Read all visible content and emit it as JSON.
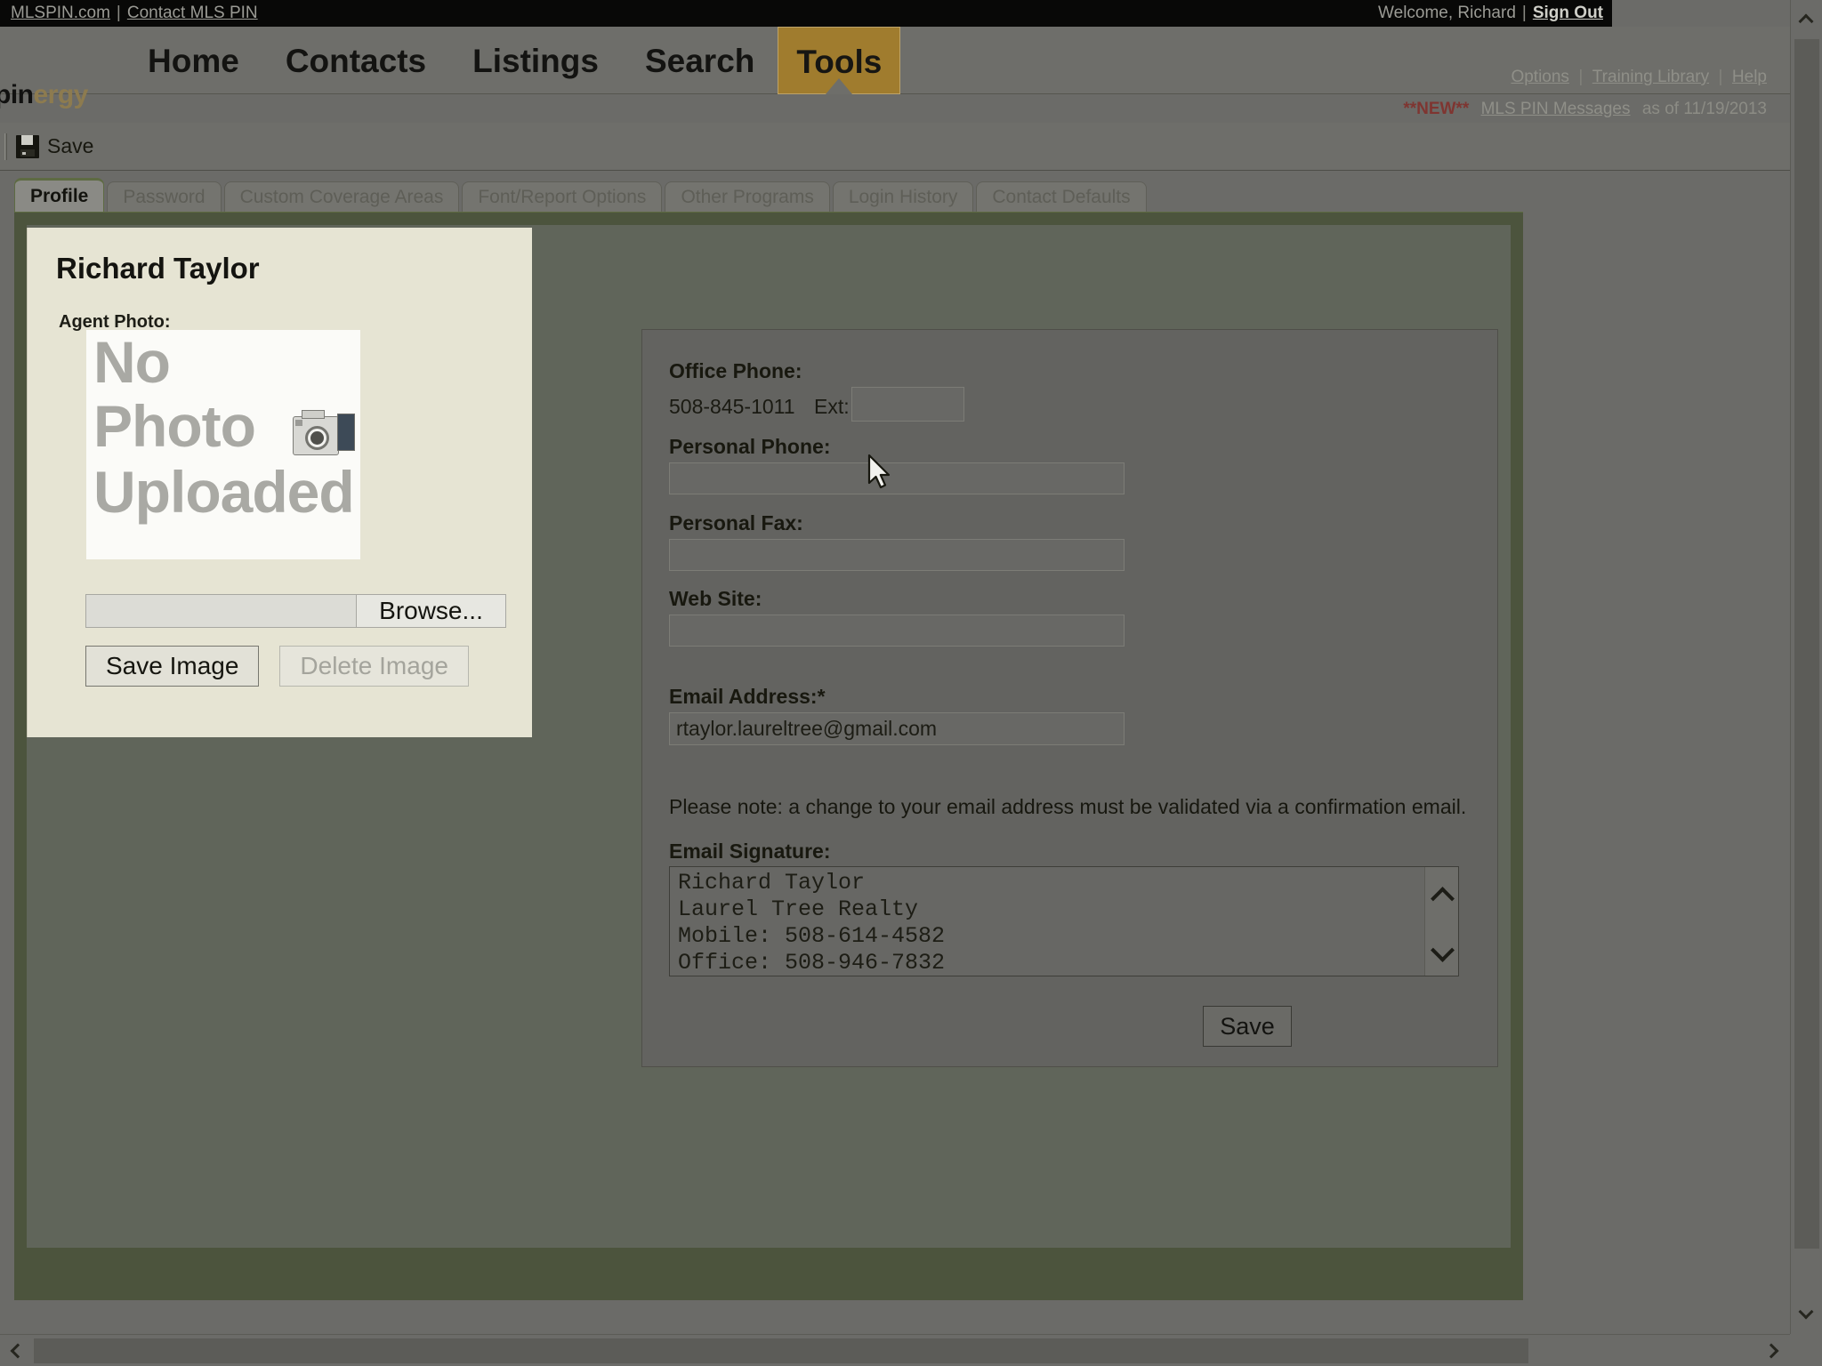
{
  "topbar": {
    "site_link": "MLSPIN.com",
    "separator": "|",
    "contact_link": "Contact MLS PIN",
    "welcome": "Welcome, Richard",
    "signout": "Sign Out"
  },
  "nav": {
    "brand_part1": "pin",
    "brand_part2": "ergy",
    "items": [
      {
        "label": "Home",
        "active": false
      },
      {
        "label": "Contacts",
        "active": false
      },
      {
        "label": "Listings",
        "active": false
      },
      {
        "label": "Search",
        "active": false
      },
      {
        "label": "Tools",
        "active": true
      }
    ],
    "options_link": "Options",
    "training_link": "Training Library",
    "help_link": "Help",
    "new_badge": "**NEW**",
    "messages_link": "MLS PIN Messages",
    "messages_suffix": "as of 11/19/2013"
  },
  "toolbar": {
    "save_label": "Save",
    "save_icon": "floppy-disk-icon"
  },
  "tabs": [
    {
      "label": "Profile",
      "active": true
    },
    {
      "label": "Password",
      "active": false
    },
    {
      "label": "Custom Coverage Areas",
      "active": false
    },
    {
      "label": "Font/Report Options",
      "active": false
    },
    {
      "label": "Other Programs",
      "active": false
    },
    {
      "label": "Login History",
      "active": false
    },
    {
      "label": "Contact Defaults",
      "active": false
    }
  ],
  "agent_card": {
    "name": "Richard Taylor",
    "photo_label": "Agent Photo:",
    "placeholder_line1": "No",
    "placeholder_line2": "Photo",
    "placeholder_line3": "Uploaded",
    "camera_icon": "camera-icon",
    "file_input_value": "",
    "browse_label": "Browse...",
    "save_image_label": "Save Image",
    "delete_image_label": "Delete Image",
    "delete_image_disabled": true
  },
  "form": {
    "office_phone_label": "Office Phone:",
    "office_phone_value": "508-845-1011",
    "ext_label": "Ext:",
    "ext_value": "",
    "personal_phone_label": "Personal Phone:",
    "personal_phone_value": "",
    "personal_fax_label": "Personal Fax:",
    "personal_fax_value": "",
    "website_label": "Web Site:",
    "website_value": "",
    "email_label": "Email Address:*",
    "email_value": "rtaylor.laureltree@gmail.com",
    "note": "Please note: a change to your email address must be validated via a confirmation email.",
    "signature_label": "Email Signature:",
    "signature_value": "Richard Taylor\nLaurel Tree Realty\nMobile: 508-614-4582\nOffice: 508-946-7832",
    "save_label": "Save"
  },
  "colors": {
    "accent_tab": "#a07c2e",
    "page_green": "#4c543d",
    "card_cream": "#e6e4d3",
    "new_red": "#7f3531"
  }
}
